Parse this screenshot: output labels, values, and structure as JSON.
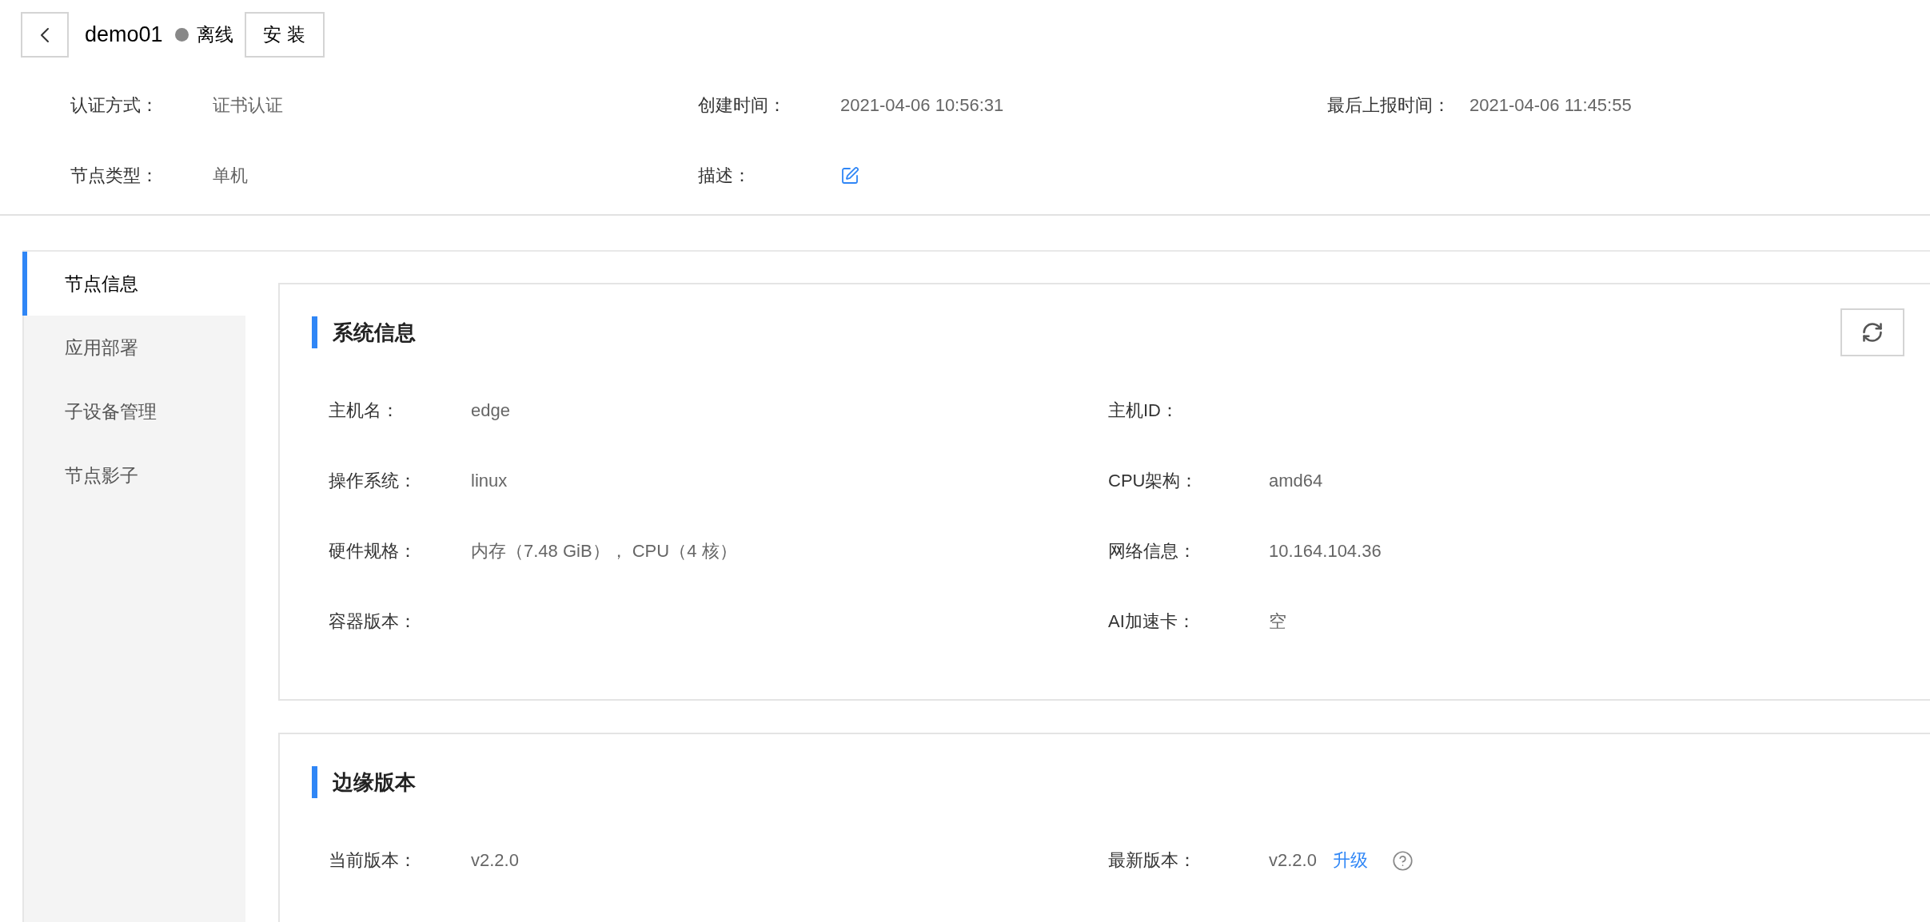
{
  "header": {
    "title": "demo01",
    "status": {
      "label": "离线",
      "online": false
    },
    "install_button": "安 装"
  },
  "meta": [
    {
      "kind": "text",
      "label": "认证方式：",
      "value": "证书认证"
    },
    {
      "kind": "text",
      "label": "创建时间：",
      "value": "2021-04-06 10:56:31"
    },
    {
      "kind": "text",
      "label": "最后上报时间：",
      "value": "2021-04-06 11:45:55"
    },
    {
      "kind": "text",
      "label": "节点类型：",
      "value": "单机"
    },
    {
      "kind": "edit",
      "label": "描述："
    }
  ],
  "sidebar": {
    "items": [
      {
        "label": "节点信息",
        "selected": true
      },
      {
        "label": "应用部署",
        "selected": false
      },
      {
        "label": "子设备管理",
        "selected": false
      },
      {
        "label": "节点影子",
        "selected": false
      }
    ]
  },
  "sections": [
    {
      "title": "系统信息",
      "refresh": true,
      "fields": [
        {
          "label": "主机名：",
          "value": "edge"
        },
        {
          "label": "主机ID："
        },
        {
          "label": "操作系统：",
          "value": "linux"
        },
        {
          "label": "CPU架构：",
          "value": "amd64"
        },
        {
          "label": "硬件规格：",
          "value": "内存（7.48 GiB）， CPU（4 核）"
        },
        {
          "label": "网络信息：",
          "value": "10.164.104.36"
        },
        {
          "label": "容器版本："
        },
        {
          "label": "AI加速卡：",
          "value": "空"
        }
      ]
    },
    {
      "title": "边缘版本",
      "refresh": false,
      "fields": [
        {
          "label": "当前版本：",
          "value": "v2.2.0"
        },
        {
          "label": "最新版本：",
          "value": "v2.2.0",
          "link": "升级",
          "help": true
        }
      ]
    }
  ]
}
